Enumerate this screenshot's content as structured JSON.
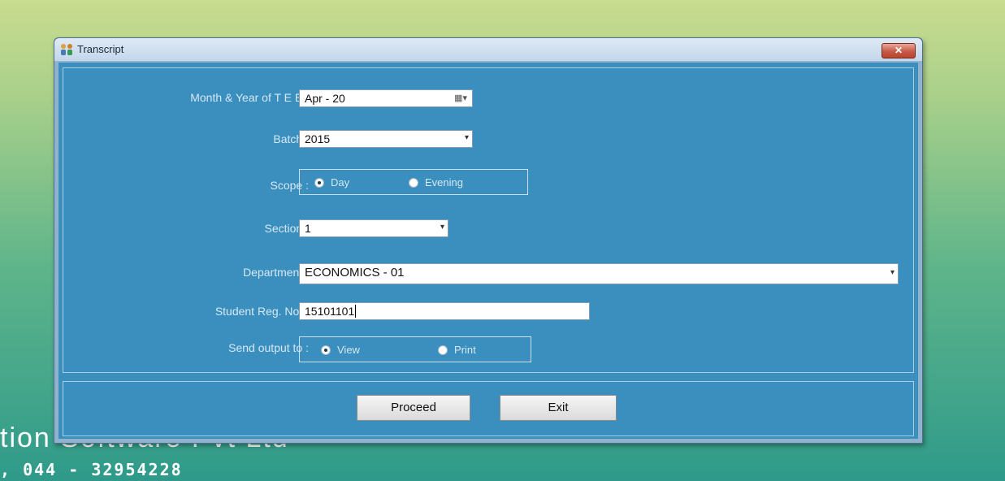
{
  "background": {
    "company_text": "tion Software Pvt Ltd",
    "phone_text": ", 044 - 32954228"
  },
  "window": {
    "title": "Transcript",
    "close_glyph": "✕"
  },
  "form": {
    "month_year": {
      "label": "Month & Year of T E E :",
      "value": "Apr  - 20",
      "calendar_glyph": "▦▾"
    },
    "batch": {
      "label": "Batch :",
      "value": "2015",
      "arrow": "▾"
    },
    "scope": {
      "label": "Scope :",
      "options": [
        {
          "label": "Day",
          "selected": true
        },
        {
          "label": "Evening",
          "selected": false
        }
      ]
    },
    "section": {
      "label": "Section :",
      "value": "1",
      "arrow": "▾"
    },
    "department": {
      "label": "Department :",
      "value": "ECONOMICS - 01",
      "arrow": "▾"
    },
    "reg_no": {
      "label": "Student Reg. No. :",
      "value": "15101101"
    },
    "send_output": {
      "label": "Send output to :",
      "options": [
        {
          "label": "View",
          "selected": true
        },
        {
          "label": "Print",
          "selected": false
        }
      ]
    }
  },
  "buttons": {
    "proceed": "Proceed",
    "exit": "Exit"
  },
  "colors": {
    "client_bg": "#3a8fbf",
    "label_text": "#d6e8f3"
  }
}
